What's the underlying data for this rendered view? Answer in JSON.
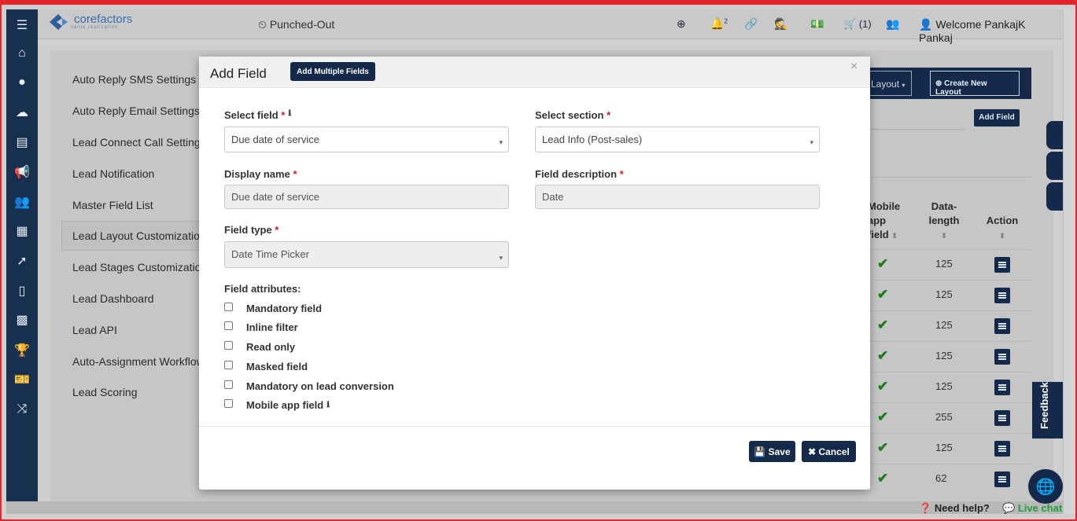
{
  "topbar": {
    "logo_text": "corefactors",
    "logo_sub": "value realization",
    "punch_status": "Punched-Out",
    "notif_count": "2",
    "cart_label": "(1)",
    "welcome": "Welcome PankajK Pankaj"
  },
  "settings_menu": [
    "Auto Reply SMS Settings",
    "Auto Reply Email Settings",
    "Lead Connect Call Settings",
    "Lead Notification",
    "Master Field List",
    "Lead Layout Customization",
    "Lead Stages Customization",
    "Lead Dashboard",
    "Lead API",
    "Auto-Assignment Workflow",
    "Lead Scoring"
  ],
  "background": {
    "layout_btn": "Layout",
    "create_layout_btn": "Create New Layout",
    "add_field_btn": "Add Field",
    "col_mobile": "Mobile app field",
    "col_data_length": "Data-length",
    "col_action": "Action",
    "data_lengths": [
      "125",
      "125",
      "125",
      "125",
      "125",
      "255",
      "125",
      "62"
    ]
  },
  "modal": {
    "title": "Add Field",
    "multi_btn": "Add Multiple Fields",
    "close": "×",
    "select_field_label": "Select field",
    "select_field_value": "Due date of service",
    "select_section_label": "Select section",
    "select_section_value": "Lead Info (Post-sales)",
    "display_name_label": "Display name",
    "display_name_value": "Due date of service",
    "field_desc_label": "Field description",
    "field_desc_value": "Date",
    "field_type_label": "Field type",
    "field_type_value": "Date Time Picker",
    "attributes_label": "Field attributes:",
    "attributes": [
      "Mandatory field",
      "Inline filter",
      "Read only",
      "Masked field",
      "Mandatory on lead conversion",
      "Mobile app field"
    ],
    "save": "Save",
    "cancel": "Cancel",
    "required_mark": "*"
  },
  "footer": {
    "help": "Need help?",
    "livechat": "Live chat",
    "feedback": "Feedback"
  },
  "colors": {
    "navy": "#15294a",
    "required": "#d0202a",
    "check": "#1a7f1a",
    "livechat": "#1e9e3a"
  }
}
